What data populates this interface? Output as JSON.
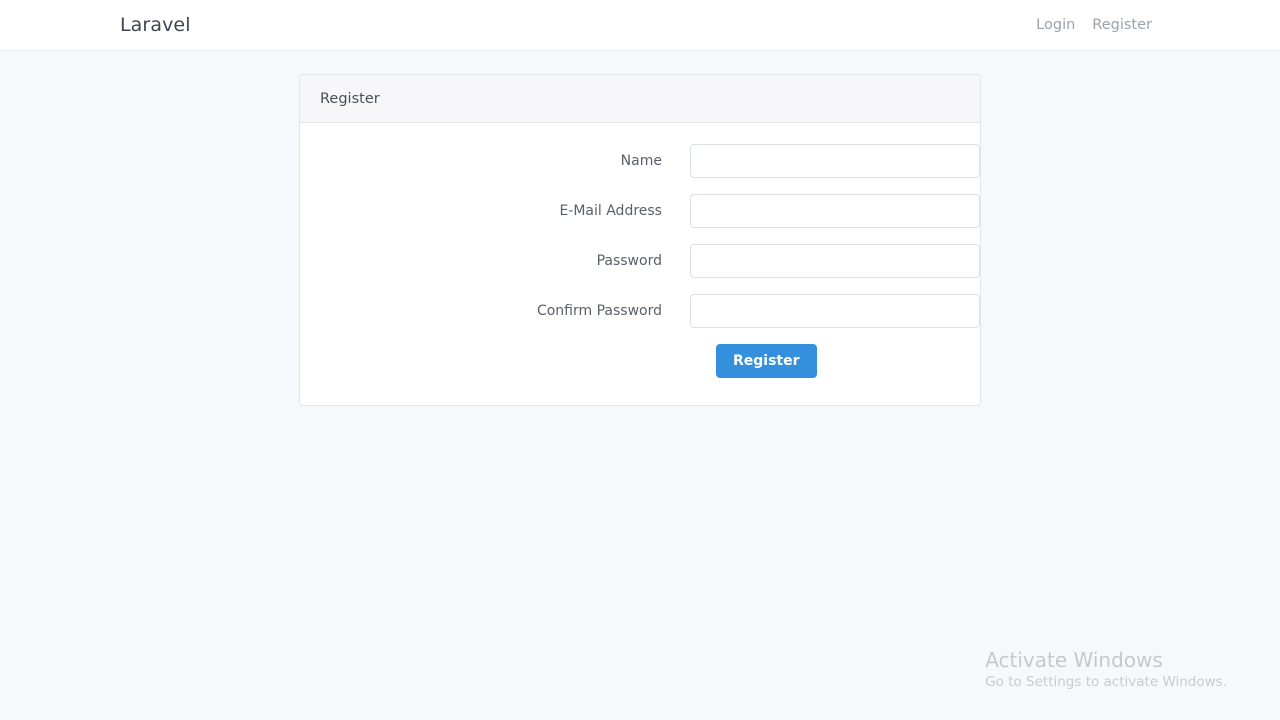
{
  "navbar": {
    "brand": "Laravel",
    "links": [
      {
        "label": "Login",
        "name": "nav-link-login"
      },
      {
        "label": "Register",
        "name": "nav-link-register"
      }
    ]
  },
  "card": {
    "header_title": "Register",
    "form": {
      "fields": [
        {
          "label": "Name",
          "value": "",
          "placeholder": "",
          "type": "text"
        },
        {
          "label": "E-Mail Address",
          "value": "",
          "placeholder": "",
          "type": "email"
        },
        {
          "label": "Password",
          "value": "",
          "placeholder": "",
          "type": "password"
        },
        {
          "label": "Confirm Password",
          "value": "",
          "placeholder": "",
          "type": "password"
        }
      ],
      "submit_label": "Register"
    }
  },
  "watermark": {
    "title": "Activate Windows",
    "subtitle": "Go to Settings to activate Windows."
  },
  "colors": {
    "primary": "#3490dc",
    "page_background": "#f7f8fb",
    "card_background": "#ffffff",
    "card_header_background": "#f7f7f9",
    "border": "#e3e6ea",
    "label_text": "#5b6068",
    "nav_link_text": "#9ba2ac",
    "watermark_text": "#c5c8cd"
  }
}
